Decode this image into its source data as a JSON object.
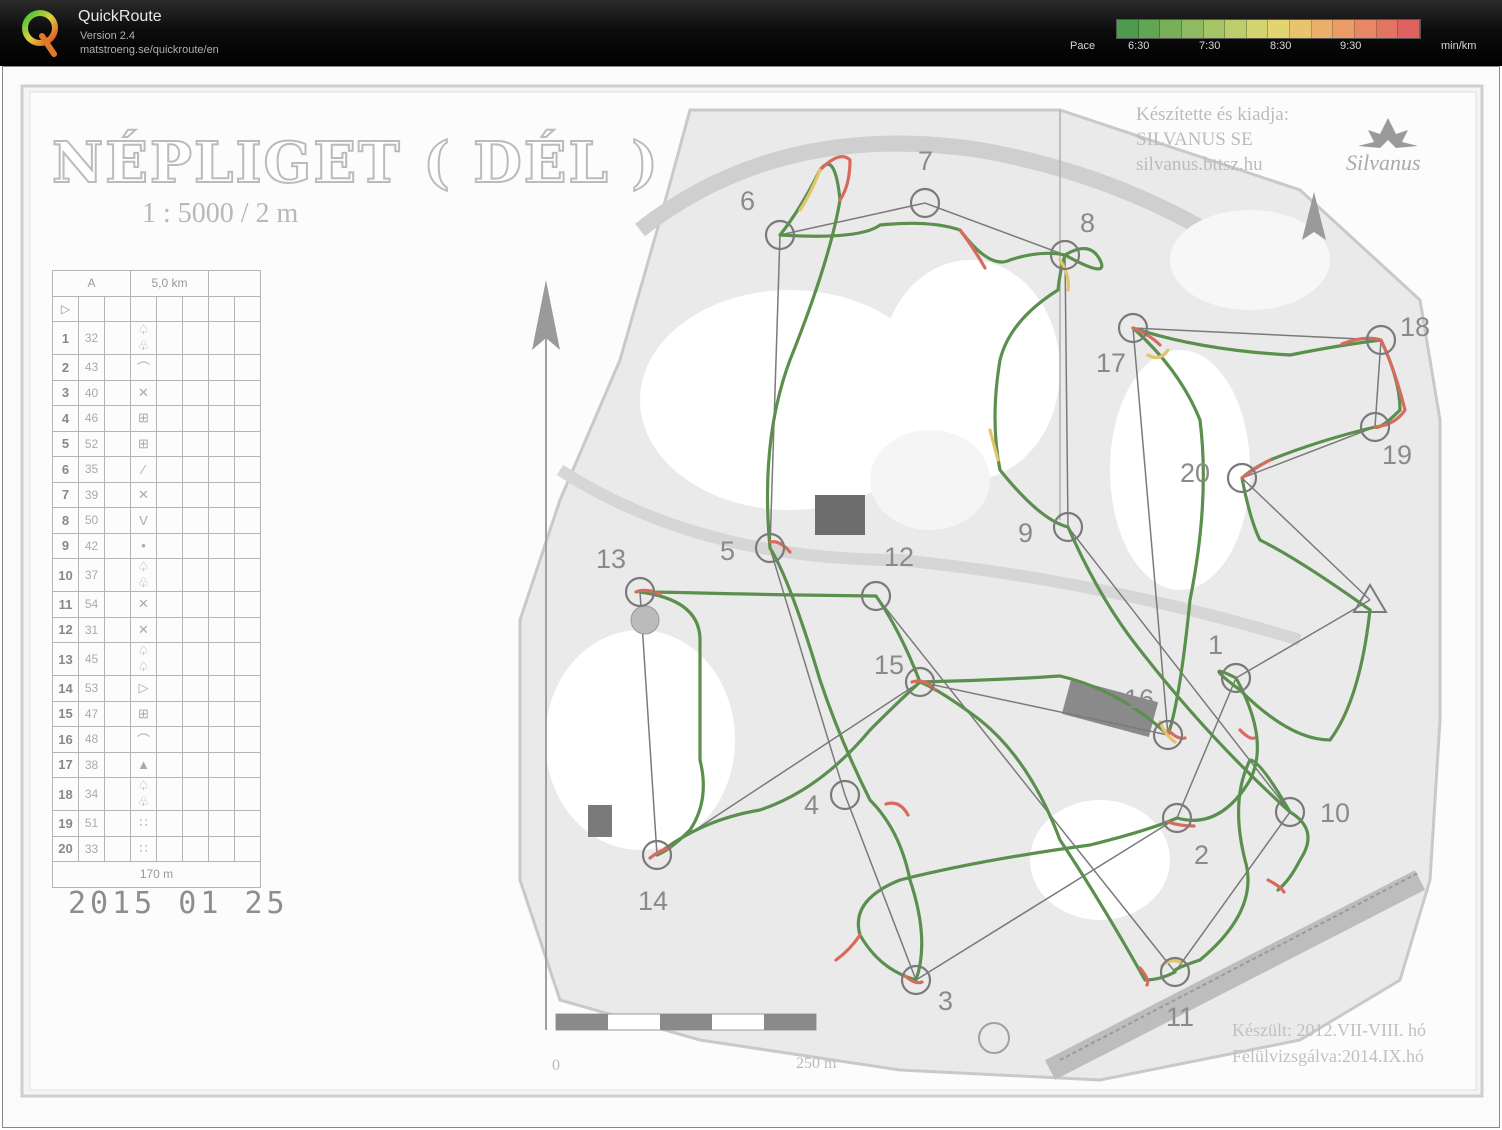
{
  "app": {
    "name": "QuickRoute",
    "version": "Version 2.4",
    "url": "matstroeng.se/quickroute/en"
  },
  "pace_legend": {
    "label": "Pace",
    "ticks": [
      "6:30",
      "7:30",
      "8:30",
      "9:30"
    ],
    "unit": "min/km",
    "colors": [
      "#4e9a4e",
      "#62a552",
      "#78b05a",
      "#8fbb60",
      "#a6c566",
      "#bccd6b",
      "#d2d46f",
      "#e3d472",
      "#e9c46f",
      "#eab06b",
      "#e99c68",
      "#e78765",
      "#e47462",
      "#e06260"
    ]
  },
  "map": {
    "title": "NÉPLIGET ( DÉL )",
    "scale": "1 : 5000 / 2 m",
    "credit": [
      "Készítette és kiadja:",
      "SILVANUS SE",
      "silvanus.bttsz.hu"
    ],
    "logo_text": "Silvanus",
    "footer": [
      "Készült: 2012.VII-VIII. hó",
      "Felülvizsgálva:2014.IX.hó"
    ],
    "handwritten_date": "2015 01 25",
    "scalebar_labels": [
      "0",
      "250 m"
    ]
  },
  "description_sheet": {
    "header": [
      "A",
      "5,0 km"
    ],
    "footer": "170 m",
    "rows": [
      {
        "n": "1",
        "code": "32",
        "sym": "♤ ♧"
      },
      {
        "n": "2",
        "code": "43",
        "sym": "⌒"
      },
      {
        "n": "3",
        "code": "40",
        "sym": "✕"
      },
      {
        "n": "4",
        "code": "46",
        "sym": "⊞"
      },
      {
        "n": "5",
        "code": "52",
        "sym": "⊞"
      },
      {
        "n": "6",
        "code": "35",
        "sym": "∕"
      },
      {
        "n": "7",
        "code": "39",
        "sym": "✕"
      },
      {
        "n": "8",
        "code": "50",
        "sym": "V"
      },
      {
        "n": "9",
        "code": "42",
        "sym": "•"
      },
      {
        "n": "10",
        "code": "37",
        "sym": "♤ ♧"
      },
      {
        "n": "11",
        "code": "54",
        "sym": "✕"
      },
      {
        "n": "12",
        "code": "31",
        "sym": "✕"
      },
      {
        "n": "13",
        "code": "45",
        "sym": "♤ ♤"
      },
      {
        "n": "14",
        "code": "53",
        "sym": "▷"
      },
      {
        "n": "15",
        "code": "47",
        "sym": "⊞"
      },
      {
        "n": "16",
        "code": "48",
        "sym": "⌒"
      },
      {
        "n": "17",
        "code": "38",
        "sym": "▲"
      },
      {
        "n": "18",
        "code": "34",
        "sym": "♤ ♧"
      },
      {
        "n": "19",
        "code": "51",
        "sym": "∷"
      },
      {
        "n": "20",
        "code": "33",
        "sym": "∷"
      }
    ]
  },
  "controls": [
    "1",
    "2",
    "3",
    "4",
    "5",
    "6",
    "7",
    "8",
    "9",
    "10",
    "11",
    "12",
    "13",
    "14",
    "15",
    "16",
    "17",
    "18",
    "19",
    "20"
  ]
}
